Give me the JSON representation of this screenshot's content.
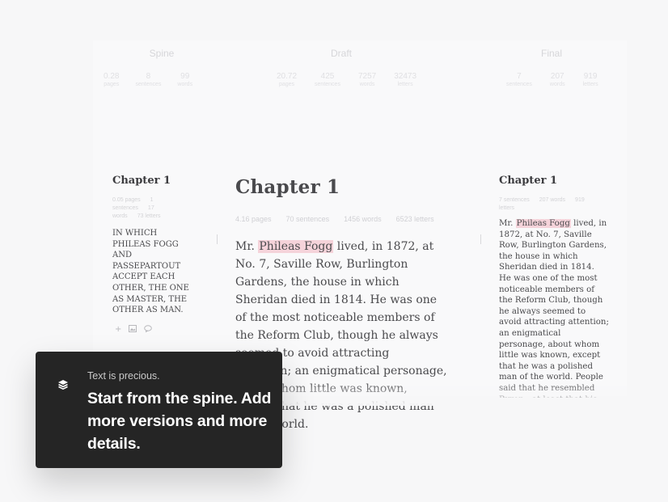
{
  "columns": [
    {
      "title": "Spine",
      "stats": [
        {
          "value": "0.28",
          "label": "pages"
        },
        {
          "value": "8",
          "label": "sentences"
        },
        {
          "value": "99",
          "label": "words"
        }
      ]
    },
    {
      "title": "Draft",
      "stats": [
        {
          "value": "20.72",
          "label": "pages"
        },
        {
          "value": "425",
          "label": "sentences"
        },
        {
          "value": "7257",
          "label": "words"
        },
        {
          "value": "32473",
          "label": "letters"
        }
      ]
    },
    {
      "title": "Final",
      "stats": [
        {
          "value": "7",
          "label": "sentences"
        },
        {
          "value": "207",
          "label": "words"
        },
        {
          "value": "919",
          "label": "letters"
        }
      ]
    }
  ],
  "spine": {
    "chapter": "Chapter 1",
    "mini_stats": [
      "0.05 pages",
      "1 sentences",
      "17 words",
      "73 letters"
    ],
    "text": "IN WHICH PHILEAS FOGG AND PASSEPARTOUT ACCEPT EACH OTHER, THE ONE AS MASTER, THE OTHER AS MAN."
  },
  "draft": {
    "chapter": "Chapter 1",
    "stats": [
      "4.16 pages",
      "70 sentences",
      "1456 words",
      "6523 letters"
    ],
    "text_before": "Mr. ",
    "highlight": "Phileas Fogg",
    "text_after": " lived, in 1872, at No. 7, Saville Row, Burlington Gardens, the house in which Sheridan died in 1814. He was one of the most noticeable members of the Reform Club, though he always seemed to avoid attracting attention; an enigmatical personage, about whom little was known, except that he was a polished man of the world."
  },
  "final": {
    "chapter": "Chapter 1",
    "mini_stats": [
      "7 sentences",
      "207 words",
      "919 letters"
    ],
    "text_before": "Mr. ",
    "highlight": "Phileas Fogg",
    "text_after": " lived, in 1872, at No. 7, Saville Row, Burlington Gardens, the house in which Sheridan died in 1814. He was one of the most noticeable members of the Reform Club, though he always seemed to avoid attracting attention; an enigmatical personage, about whom little was known, except that he was a polished man of the world. People said that he resembled Byron—at least that his head was"
  },
  "spine_tools": {
    "add": "+",
    "image": "image-icon",
    "comment": "comment-icon"
  },
  "toast": {
    "icon": "layers-icon",
    "eyebrow": "Text is precious.",
    "message": "Start from the spine. Add more versions and more details."
  },
  "colors": {
    "highlight": "#f5d3da",
    "toast_bg": "#252525"
  }
}
